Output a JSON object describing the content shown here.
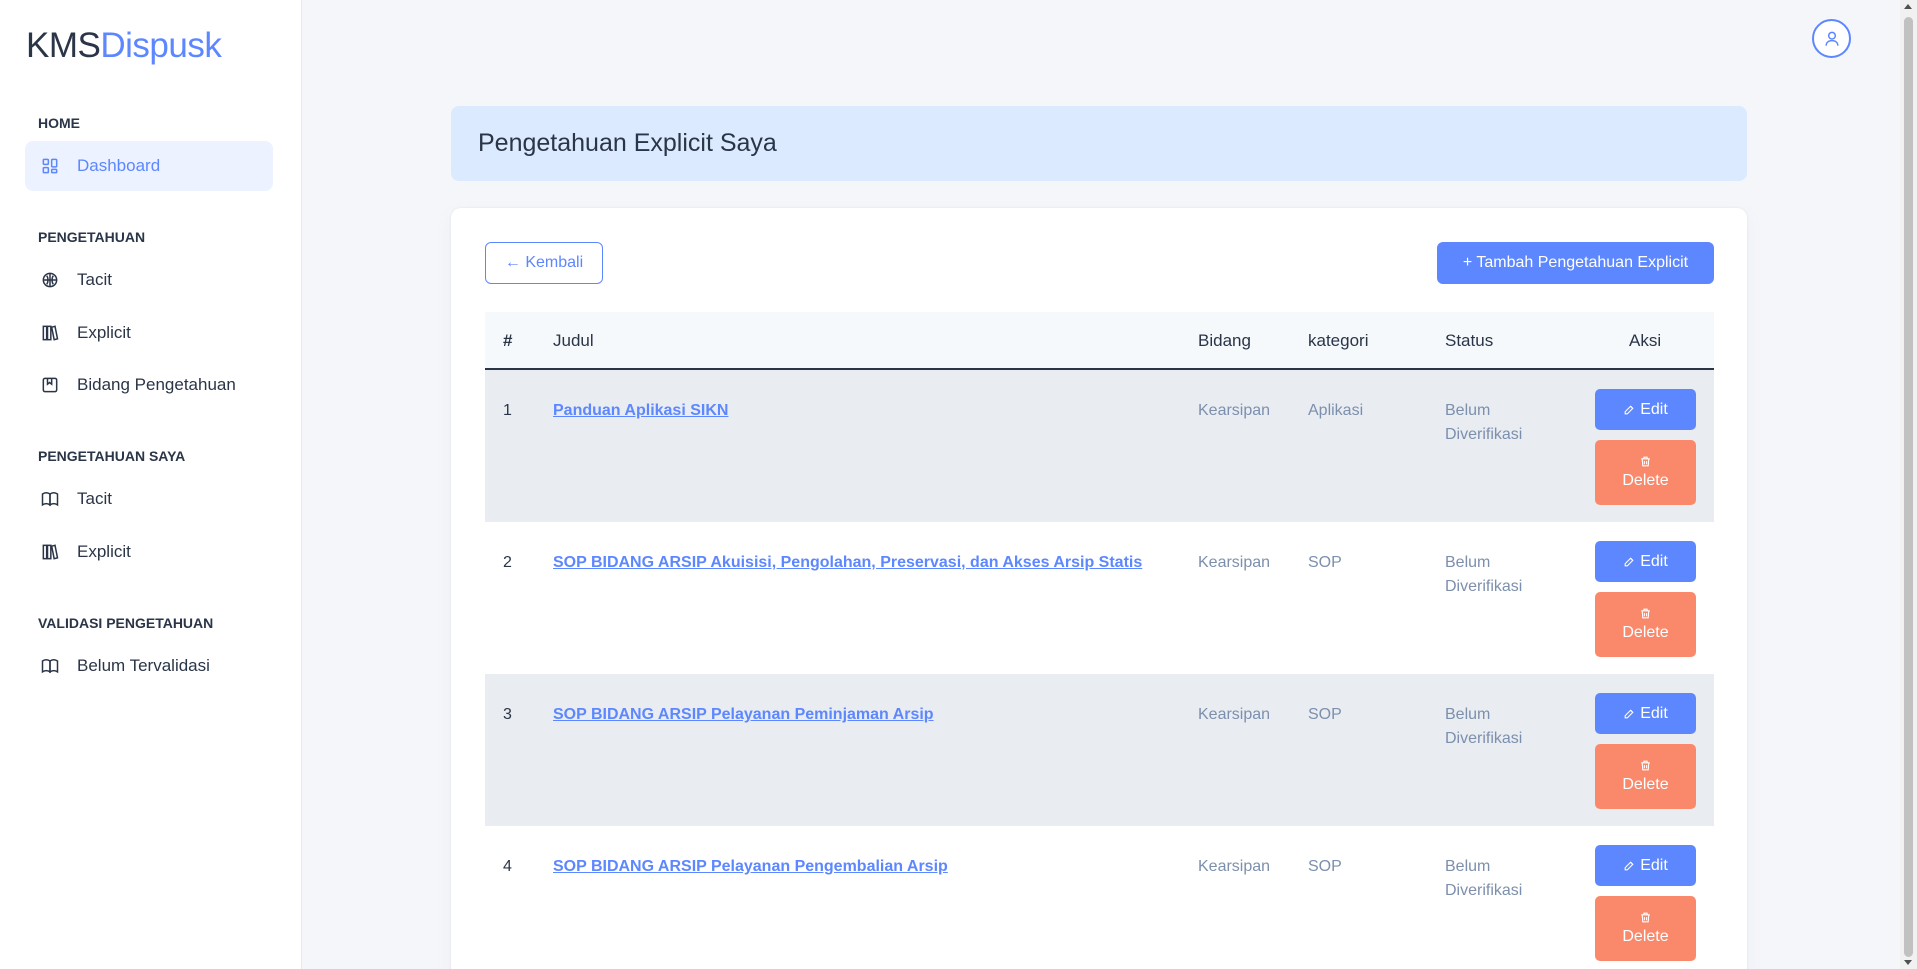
{
  "brand": {
    "part1": "KMS",
    "part2": "Dispusk"
  },
  "sidebar": {
    "sections": [
      {
        "label": "HOME"
      },
      {
        "label": "PENGETAHUAN"
      },
      {
        "label": "PENGETAHUAN SAYA"
      },
      {
        "label": "VALIDASI PENGETAHUAN"
      }
    ],
    "items": [
      {
        "label": "Dashboard",
        "icon": "dashboard-icon"
      },
      {
        "label": "Tacit",
        "icon": "brain-icon"
      },
      {
        "label": "Explicit",
        "icon": "books-icon"
      },
      {
        "label": "Bidang Pengetahuan",
        "icon": "bookmark-icon"
      },
      {
        "label": "Tacit",
        "icon": "book-open-icon"
      },
      {
        "label": "Explicit",
        "icon": "books-icon"
      },
      {
        "label": "Belum Tervalidasi",
        "icon": "book-open-icon"
      }
    ]
  },
  "page": {
    "title": "Pengetahuan Explicit Saya"
  },
  "actions": {
    "back_label": "← Kembali",
    "add_label": "+ Tambah Pengetahuan Explicit"
  },
  "table": {
    "headers": [
      "#",
      "Judul",
      "Bidang",
      "kategori",
      "Status",
      "Aksi"
    ],
    "edit_label": "Edit",
    "delete_label": "Delete",
    "rows": [
      {
        "no": "1",
        "judul": "Panduan Aplikasi SIKN",
        "bidang": "Kearsipan",
        "kategori": "Aplikasi",
        "status_1": "Belum",
        "status_2": "Diverifikasi"
      },
      {
        "no": "2",
        "judul": "SOP BIDANG ARSIP Akuisisi, Pengolahan, Preservasi, dan Akses Arsip Statis",
        "bidang": "Kearsipan",
        "kategori": "SOP",
        "status_1": "Belum",
        "status_2": "Diverifikasi"
      },
      {
        "no": "3",
        "judul": "SOP BIDANG ARSIP Pelayanan Peminjaman Arsip",
        "bidang": "Kearsipan",
        "kategori": "SOP",
        "status_1": "Belum",
        "status_2": "Diverifikasi"
      },
      {
        "no": "4",
        "judul": "SOP BIDANG ARSIP Pelayanan Pengembalian Arsip",
        "bidang": "Kearsipan",
        "kategori": "SOP",
        "status_1": "Belum",
        "status_2": "Diverifikasi"
      }
    ]
  },
  "colors": {
    "primary": "#5d87ff",
    "danger": "#fa896b",
    "banner": "#dbeafe",
    "active_nav": "#ecf2ff"
  }
}
